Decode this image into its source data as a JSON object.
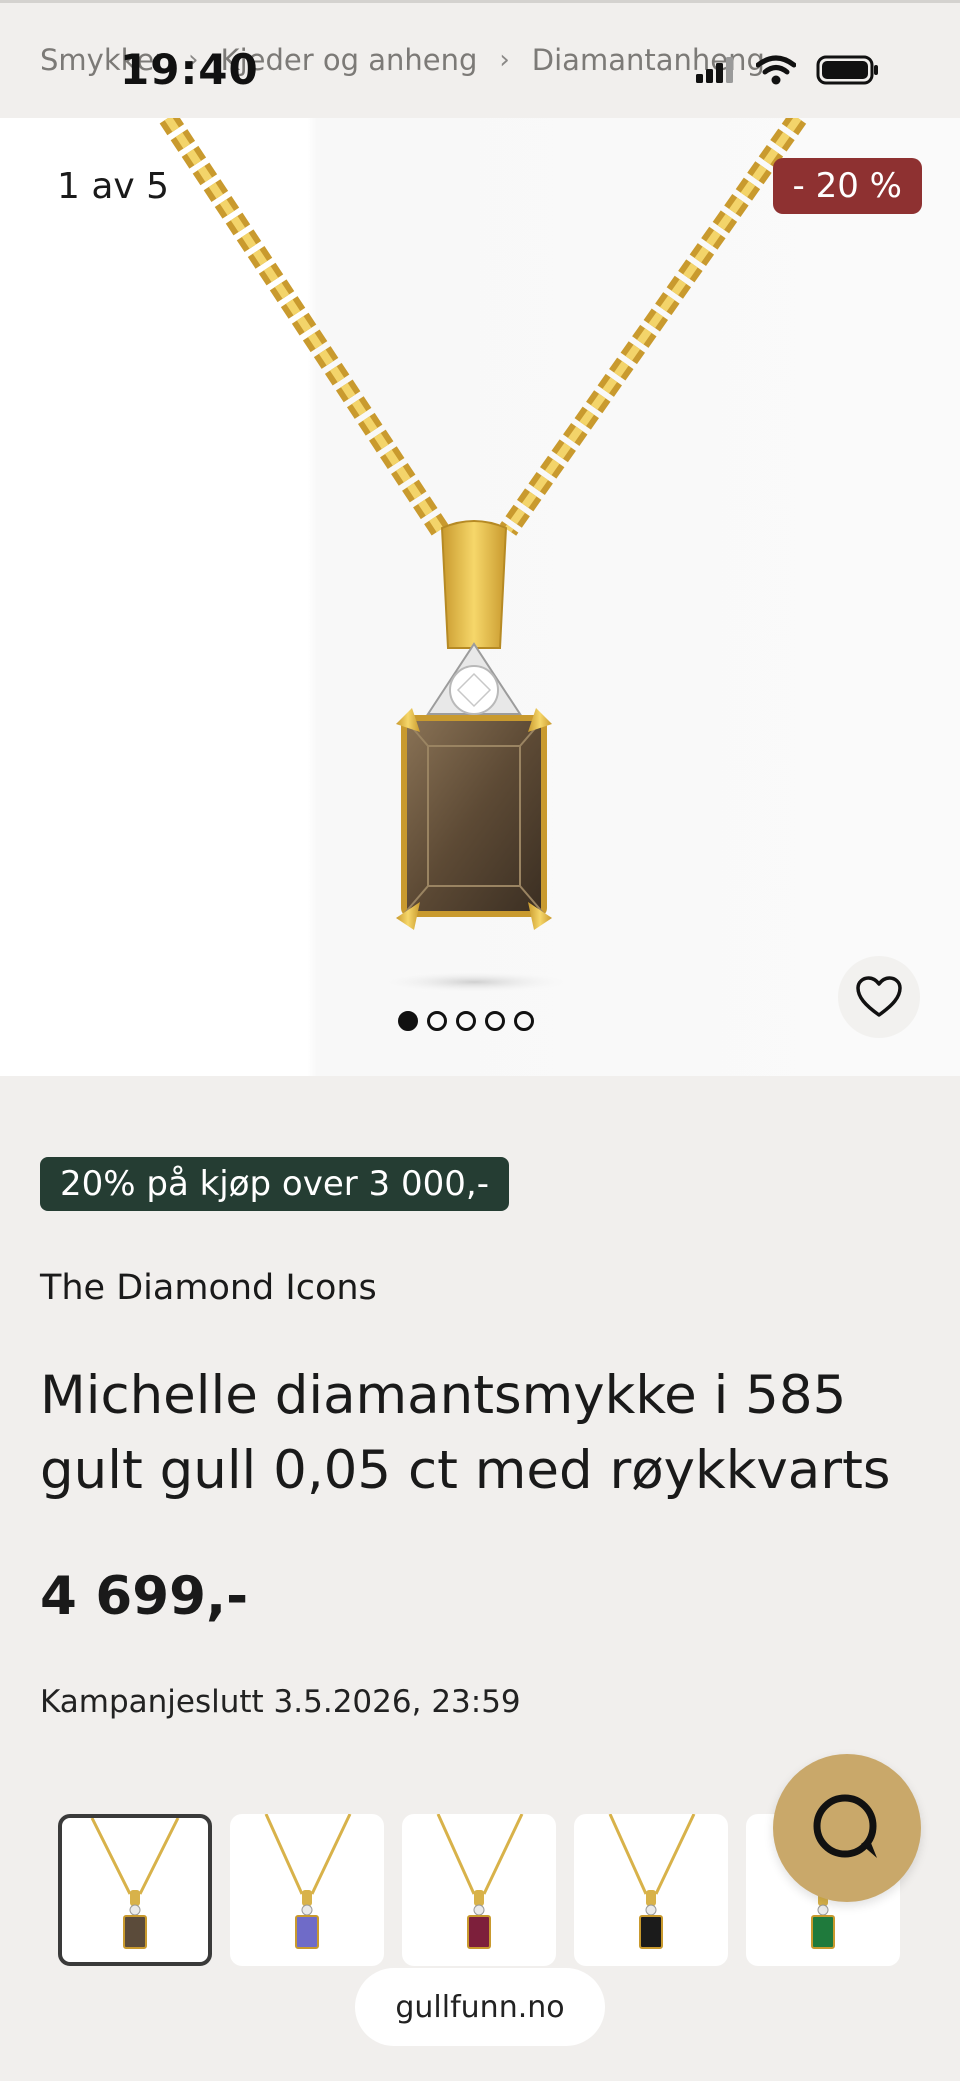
{
  "status_bar": {
    "time": "19:40"
  },
  "breadcrumb": {
    "items": [
      "Smykker",
      "Kjeder og anheng",
      "Diamantanheng"
    ]
  },
  "gallery": {
    "counter": "1 av 5",
    "discount_badge": "- 20 %",
    "slide_count": 5,
    "active_slide": 1
  },
  "product": {
    "promo_badge": "20% på kjøp over 3 000,-",
    "brand": "The Diamond Icons",
    "title": "Michelle diamantsmykke i 585 gult gull 0,05 ct med røykkvarts",
    "price": "4 699,-",
    "campaign_end": "Kampanjeslutt 3.5.2026, 23:59"
  },
  "thumbnails": [
    {
      "stone": "smoky-quartz",
      "color": "#5b4b3a",
      "active": true
    },
    {
      "stone": "tanzanite",
      "color": "#6f6bc8",
      "active": false
    },
    {
      "stone": "rhodolite",
      "color": "#7d1f3b",
      "active": false
    },
    {
      "stone": "onyx",
      "color": "#1b1b1b",
      "active": false
    },
    {
      "stone": "emerald",
      "color": "#1f7a3c",
      "active": false
    }
  ],
  "footer": {
    "url": "gullfunn.no"
  },
  "colors": {
    "accent_gold": "#c9a86a",
    "discount_red": "#8e3131",
    "promo_green": "#253d33"
  },
  "icons": [
    "signal-icon",
    "wifi-icon",
    "battery-icon",
    "heart-icon",
    "chat-icon"
  ]
}
